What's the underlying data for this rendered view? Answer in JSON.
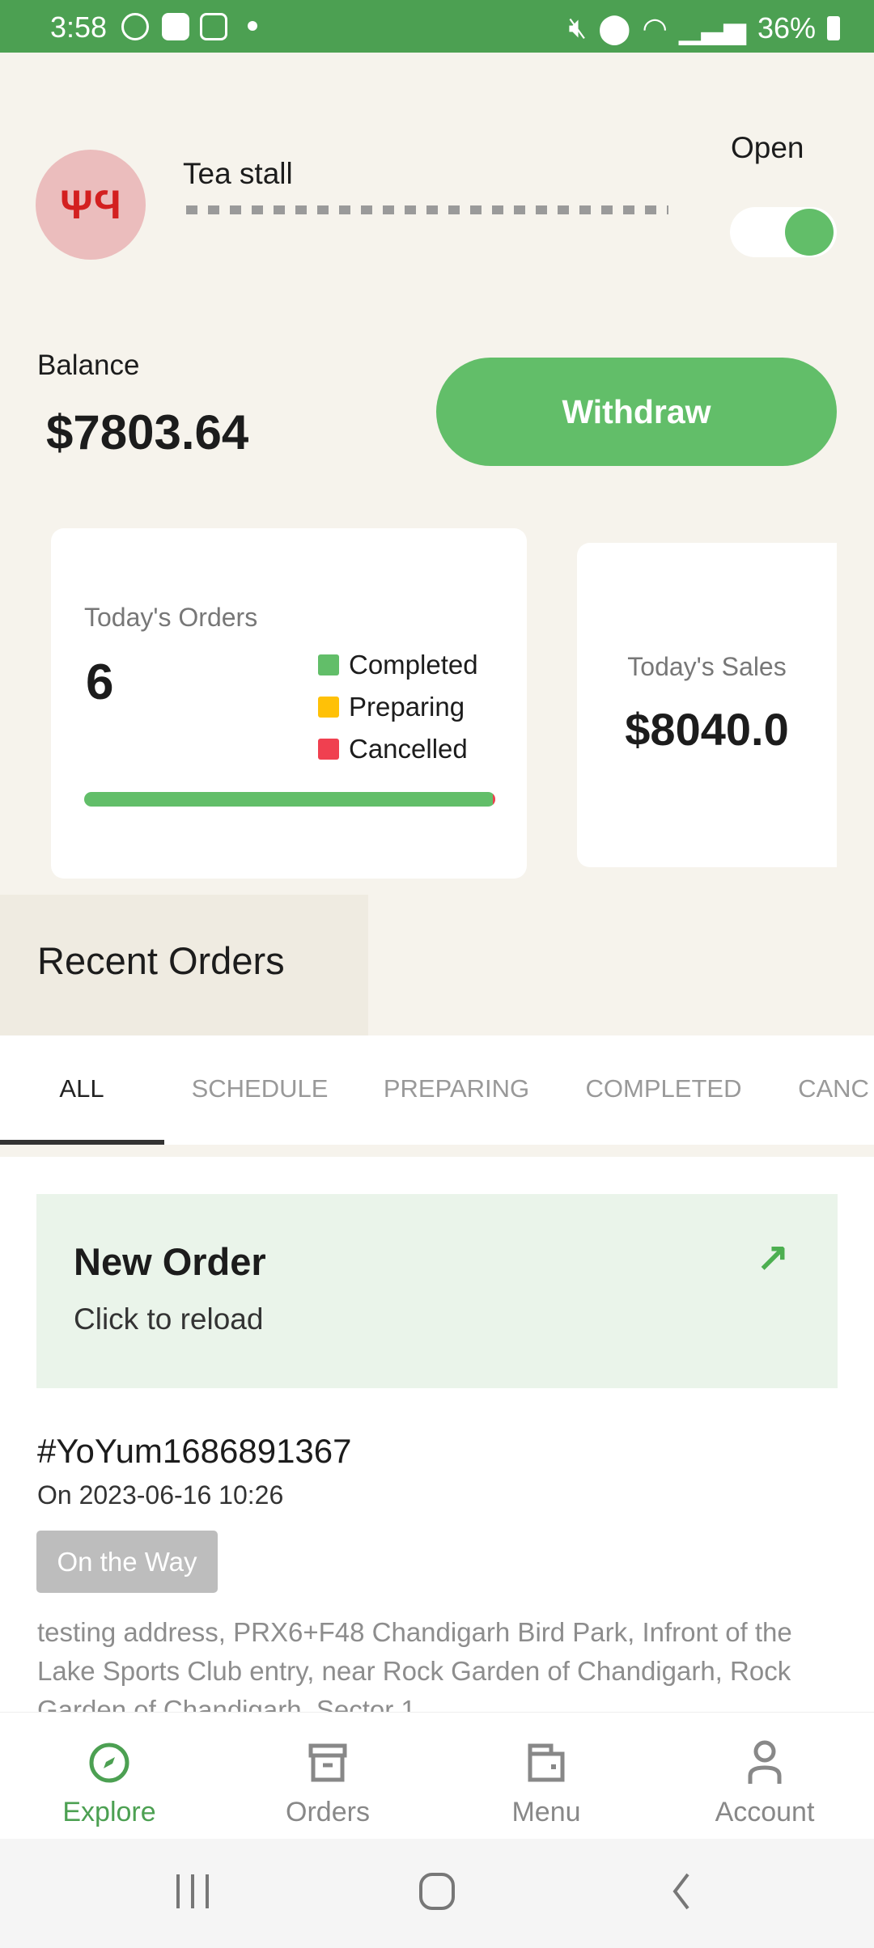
{
  "status_bar": {
    "time": "3:58",
    "battery": "36%",
    "icons": [
      "face-icon",
      "app-icon",
      "gallery-icon",
      "dot-icon",
      "mute-icon",
      "location-icon",
      "wifi-icon",
      "signal-icon",
      "battery-charging-icon"
    ]
  },
  "store": {
    "name": "Tea stall",
    "open_label": "Open",
    "is_open": true,
    "icon": "restaurant-icon"
  },
  "balance": {
    "label": "Balance",
    "amount": "$7803.64",
    "withdraw_label": "Withdraw"
  },
  "orders_card": {
    "title": "Today's Orders",
    "count": "6",
    "legend": [
      {
        "label": "Completed",
        "color": "#62BE69"
      },
      {
        "label": "Preparing",
        "color": "#FFC107"
      },
      {
        "label": "Cancelled",
        "color": "#F04050"
      }
    ],
    "completed_fraction": 0.99
  },
  "sales_card": {
    "title": "Today's Sales",
    "amount": "$8040.0"
  },
  "recent": {
    "title": "Recent Orders",
    "tabs": [
      "ALL",
      "SCHEDULE",
      "PREPARING",
      "COMPLETED",
      "CANC"
    ],
    "active_tab": "ALL"
  },
  "new_order": {
    "title": "New Order",
    "subtitle": "Click to reload",
    "icon": "arrow-up-right-icon"
  },
  "order": {
    "id": "#YoYum1686891367",
    "date": "On 2023-06-16 10:26",
    "status": "On the Way",
    "address": "testing address, PRX6+F48 Chandigarh Bird Park, Infront of the Lake Sports Club entry, near Rock Garden of Chandigarh, Rock Garden of Chandigarh, Sector 1"
  },
  "nav": [
    {
      "label": "Explore",
      "icon": "compass-icon",
      "active": true
    },
    {
      "label": "Orders",
      "icon": "archive-icon"
    },
    {
      "label": "Menu",
      "icon": "wallet-icon"
    },
    {
      "label": "Account",
      "icon": "user-icon"
    }
  ],
  "colors": {
    "accent": "#62BE69",
    "status_bar": "#4CA052",
    "background": "#F6F3EC"
  }
}
